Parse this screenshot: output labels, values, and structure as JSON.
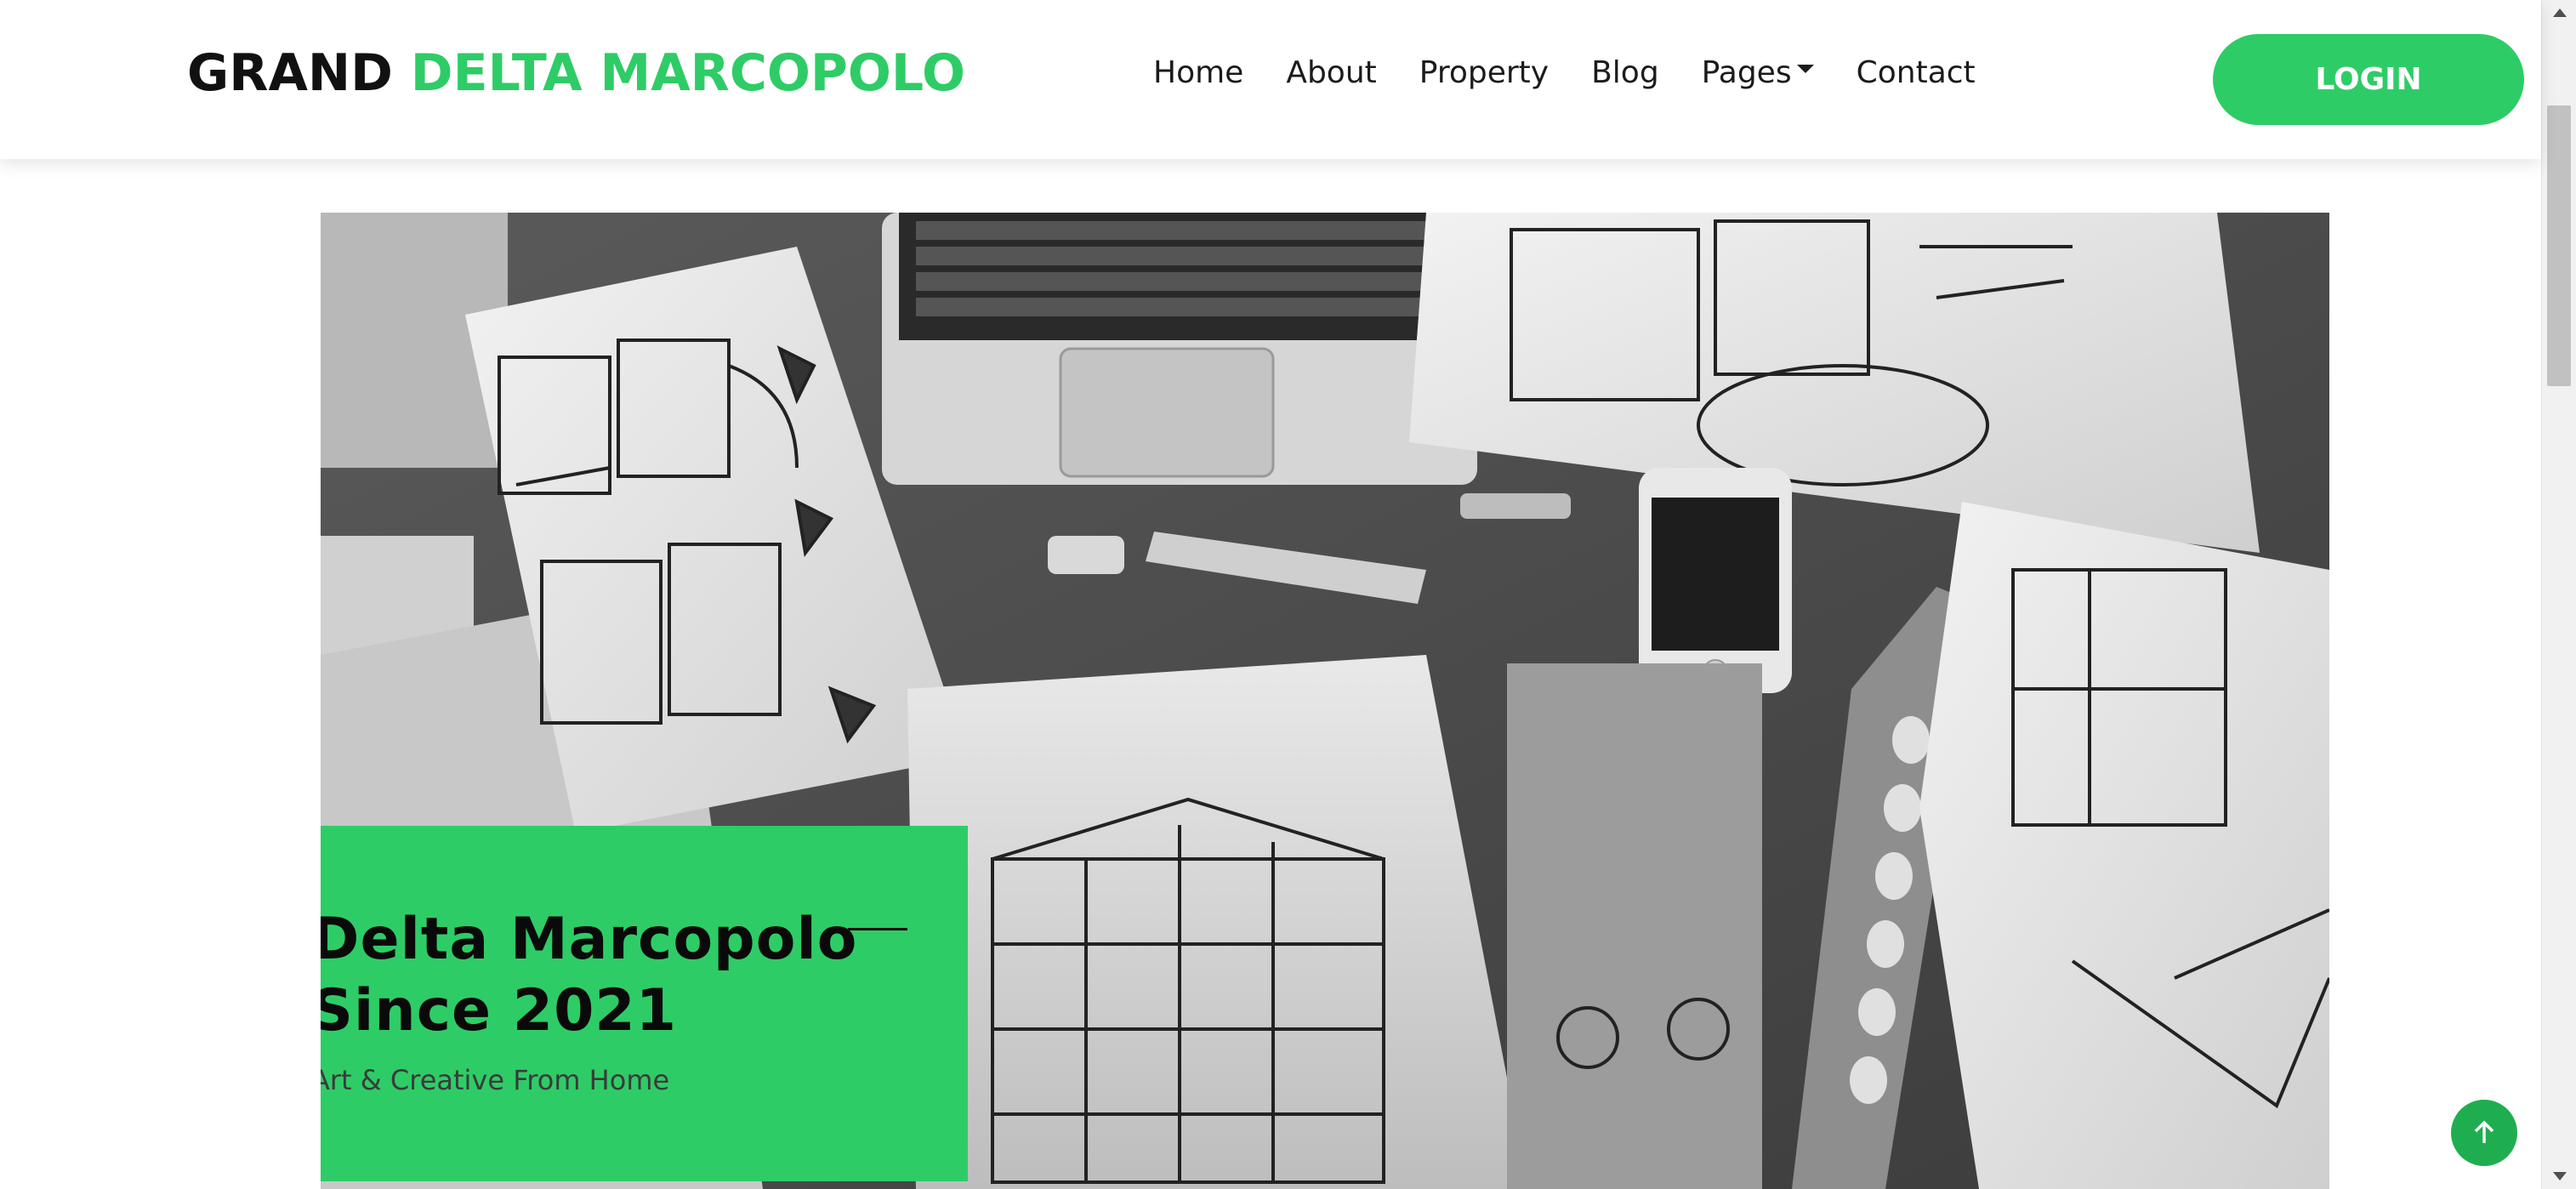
{
  "brand": {
    "part1": "GRAND",
    "part2": "DELTA MARCOPOLO"
  },
  "nav": {
    "items": [
      {
        "label": "Home"
      },
      {
        "label": "About"
      },
      {
        "label": "Property"
      },
      {
        "label": "Blog"
      },
      {
        "label": "Pages",
        "dropdown": true
      },
      {
        "label": "Contact"
      }
    ],
    "login_label": "LOGIN"
  },
  "hero": {
    "title": "Delta Marcopolo Since 2021",
    "subtitle": "Art & Creative From Home"
  },
  "icons": {
    "scroll_top": "arrow-up-icon",
    "dropdown": "caret-down-icon"
  },
  "colors": {
    "accent": "#2ecc66",
    "text": "#111111",
    "to_top": "#1fae4f"
  }
}
